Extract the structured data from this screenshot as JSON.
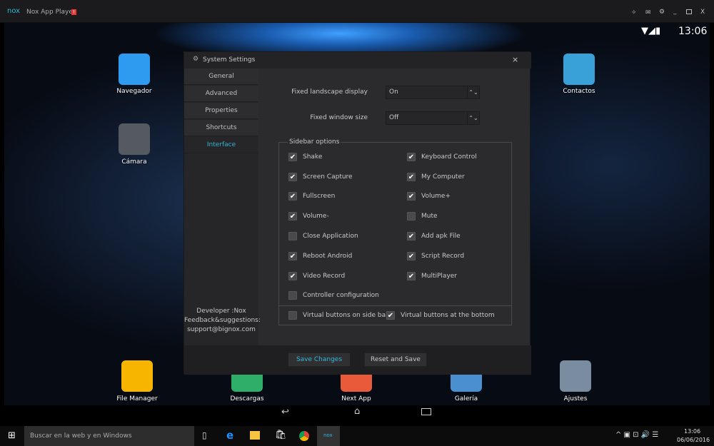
{
  "window": {
    "logo": "nox",
    "title": "Nox App Player",
    "badge": "!",
    "controls": [
      "pin-icon",
      "message-icon",
      "gear-icon",
      "minimize-icon",
      "maximize-icon",
      "close-icon"
    ]
  },
  "status_bar": {
    "time": "13:06"
  },
  "desktop": {
    "icons": [
      {
        "label": "Navegador",
        "color": "#2e9bf0"
      },
      {
        "label": "Cámara",
        "color": "#555a60"
      },
      {
        "label": "Contactos",
        "color": "#3aa0d8"
      },
      {
        "label": "File Manager",
        "color": "#f7b500"
      },
      {
        "label": "Descargas",
        "color": "#2fae6a"
      },
      {
        "label": "Next App",
        "color": "#e85a3a"
      },
      {
        "label": "Galería",
        "color": "#4a8fd0"
      },
      {
        "label": "Ajustes",
        "color": "#7a8ca0"
      }
    ]
  },
  "dialog": {
    "title": "System Settings",
    "close": "×",
    "tabs": [
      "General",
      "Advanced",
      "Properties",
      "Shortcuts",
      "Interface"
    ],
    "active_tab": "Interface",
    "developer": [
      "Developer :Nox",
      "Feedback&suggestions:",
      "support@bignox.com"
    ],
    "fields": [
      {
        "label": "Fixed landscape display",
        "value": "On"
      },
      {
        "label": "Fixed window size",
        "value": "Off"
      }
    ],
    "group_title": "Sidebar options",
    "options_left": [
      {
        "label": "Shake",
        "checked": true
      },
      {
        "label": "Screen Capture",
        "checked": true
      },
      {
        "label": "Fullscreen",
        "checked": true
      },
      {
        "label": "Volume-",
        "checked": true
      },
      {
        "label": "Close Application",
        "checked": false
      },
      {
        "label": "Reboot Android",
        "checked": true
      },
      {
        "label": "Video Record",
        "checked": true
      },
      {
        "label": "Controller configuration",
        "checked": false
      }
    ],
    "options_right": [
      {
        "label": "Keyboard Control",
        "checked": true
      },
      {
        "label": "My Computer",
        "checked": true
      },
      {
        "label": "Volume+",
        "checked": true
      },
      {
        "label": "Mute",
        "checked": false
      },
      {
        "label": "Add apk File",
        "checked": true
      },
      {
        "label": "Script Record",
        "checked": true
      },
      {
        "label": "MultiPlayer",
        "checked": true
      }
    ],
    "virtual": [
      {
        "label": "Virtual buttons on side bar",
        "checked": false
      },
      {
        "label": "Virtual buttons at the bottom",
        "checked": true
      }
    ],
    "save": "Save Changes",
    "reset": "Reset and Save",
    "accent": "#2fb8d8"
  },
  "taskbar": {
    "search_placeholder": "Buscar en la web y en Windows",
    "time": "13:06",
    "date": "06/06/2016"
  }
}
